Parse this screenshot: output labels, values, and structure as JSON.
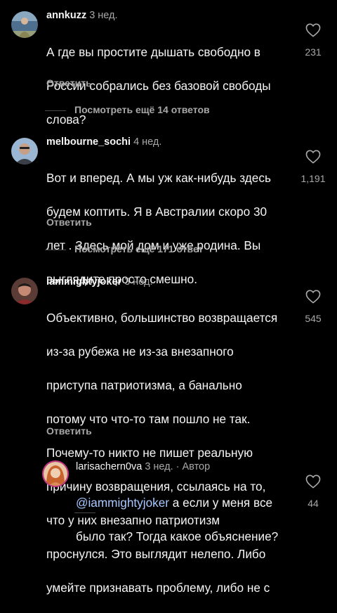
{
  "comments": [
    {
      "username": "annkuzz",
      "time": "3 нед.",
      "lines": [
        "А где вы простите дышать свободно в",
        "России собрались без базовой свободы",
        "слова?"
      ],
      "reply_label": "Ответить",
      "likes": "231",
      "more_replies": "Посмотреть ещё 14 ответов"
    },
    {
      "username": "melbourne_sochi",
      "time": "4 нед.",
      "lines": [
        "Вот и вперед. А мы уж как-нибудь здесь",
        "будем коптить. Я в Австралии скоро 30",
        "лет . Здесь мой дом и уже родина. Вы",
        "выглядите просто смешно."
      ],
      "reply_label": "Ответить",
      "likes": "1,191",
      "more_replies": "Посмотреть ещё 171 ответ"
    },
    {
      "username": "iammightyjoker",
      "time": "3 нед.",
      "lines": [
        "Объективно, большинство возвращается",
        "из-за рубежа не из-за внезапного",
        "приступа патриотизма, а банально",
        "потому что что-то там пошло не так.",
        "Почему-то никто не пишет реальную",
        "причину возвращения, ссылаясь на то,",
        "что у них внезапно патриотизм",
        "проснулся. Это выглядит нелепо. Либо",
        "умейте признавать проблему, либо не с"
      ],
      "reply_label": "Ответить",
      "likes": "545"
    },
    {
      "username": "larisachern0va",
      "time": "3 нед.",
      "author_tag": "· Автор",
      "mention": "@iammightyjoker",
      "line1_rest": " а если у меня все",
      "line2": "было так? Тогда какое объяснение?",
      "likes": "44"
    }
  ],
  "icons": {
    "like": "heart-outline-icon"
  },
  "colors": {
    "background": "#000000",
    "text": "#f5f5f5",
    "secondary": "#a8a8a8",
    "mention": "#a8c8ff"
  }
}
